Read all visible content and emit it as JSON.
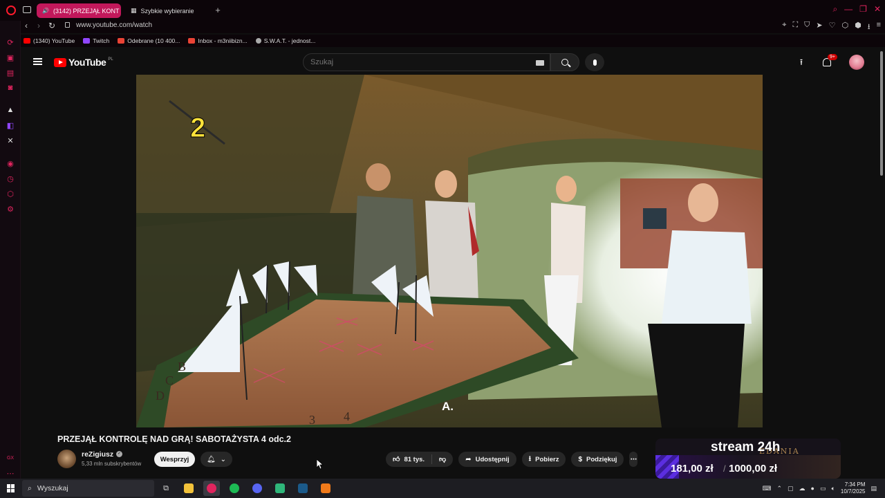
{
  "browser": {
    "tabs": [
      {
        "label": "(3142) PRZEJĄŁ KONT",
        "active": true
      },
      {
        "label": "Szybkie wybieranie",
        "active": false
      }
    ],
    "url": "www.youtube.com/watch",
    "bookmarks": [
      {
        "label": "(1340) YouTube",
        "icon": "youtube-icon",
        "color": "#ff0000"
      },
      {
        "label": "Twitch",
        "icon": "twitch-icon",
        "color": "#9146ff"
      },
      {
        "label": "Odebrane (10 400...",
        "icon": "gmail-icon",
        "color": "#ea4335"
      },
      {
        "label": "Inbox - m3niibizn...",
        "icon": "gmail-icon",
        "color": "#ea4335"
      },
      {
        "label": "S.W.A.T. - jednost...",
        "icon": "globe-icon",
        "color": "#aaaaaa"
      }
    ],
    "sidebar_label": "GX",
    "accent": "#e0245e"
  },
  "youtube": {
    "logo_text": "YouTube",
    "logo_region": "PL",
    "search_placeholder": "Szukaj",
    "notification_count": "9+"
  },
  "video": {
    "overlay_number": "2",
    "caption": "A.",
    "board_letters": [
      "A",
      "B",
      "C",
      "D"
    ],
    "board_numbers": [
      "1",
      "2",
      "3",
      "4"
    ]
  },
  "watch": {
    "title": "PRZEJĄŁ KONTROLĘ NAD GRĄ! SABOTAŻYSTA 4 odc.2",
    "channel_name": "reZigiusz",
    "subscribers": "5,33 mln subskrybentów",
    "support_label": "Wesprzyj",
    "likes": "81 tys.",
    "share_label": "Udostępnij",
    "download_label": "Pobierz",
    "thanks_label": "Podziękuj"
  },
  "promo": {
    "title": "stream 24h",
    "value_current": "181,00 zł",
    "separator": "/",
    "value_goal": "1000,00 zł",
    "brand": "EDANIA"
  },
  "taskbar": {
    "search_label": "Wyszukaj",
    "time": "7:34 PM",
    "date": "10/7/2025",
    "apps": [
      "task-view-icon",
      "file-explorer-icon",
      "opera-gx-icon",
      "spotify-icon",
      "discord-icon",
      "android-studio-icon",
      "steam-icon",
      "app-icon"
    ]
  }
}
